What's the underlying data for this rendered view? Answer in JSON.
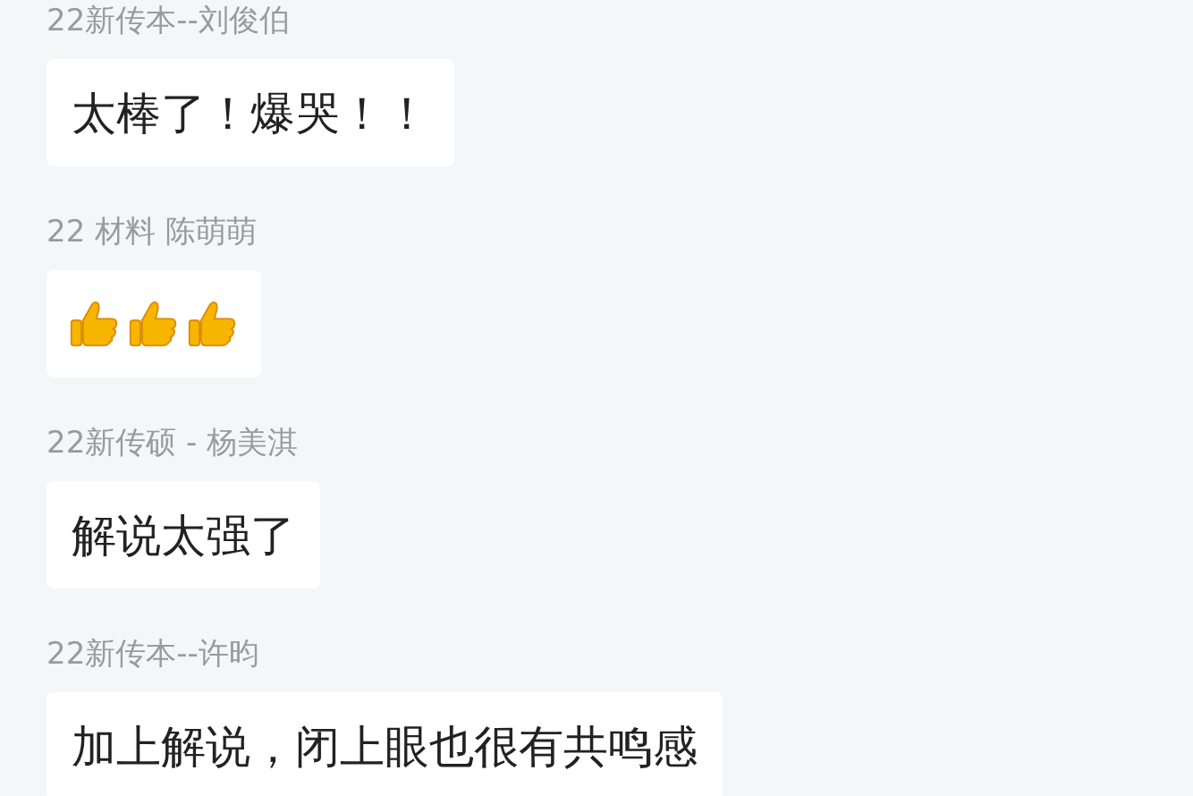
{
  "messages": [
    {
      "sender": "22新传本--刘俊伯",
      "kind": "text",
      "text": "太棒了！爆哭！！"
    },
    {
      "sender": "22 材料 陈萌萌",
      "kind": "stickers",
      "stickers": [
        {
          "kind": "thumbs-up"
        },
        {
          "kind": "thumbs-up"
        },
        {
          "kind": "thumbs-up"
        }
      ]
    },
    {
      "sender": "22新传硕 - 杨美淇",
      "kind": "text",
      "text": "解说太强了"
    },
    {
      "sender": "22新传本--许昀",
      "kind": "text",
      "text": "加上解说，闭上眼也很有共鸣感"
    }
  ]
}
